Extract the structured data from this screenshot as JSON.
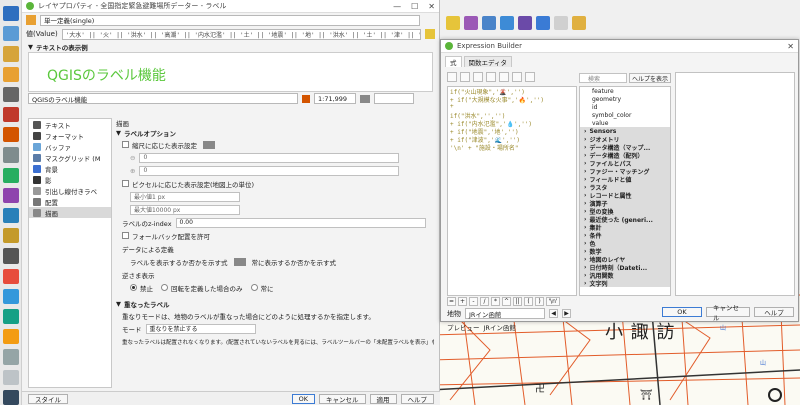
{
  "props_window": {
    "title": "レイヤプロパティ - 全国指定緊急避難場所データー - ラベル",
    "layer_mode": "単一定義(single)",
    "value_label": "値(Value)",
    "expression": "'大水' || '火' || '洪水' || '高潮' || '内水氾濫' || '土' || '地震' || '地' || '洪水' || '土' || '津' || '施設・場所名'",
    "sample_section": "テキストの表示例",
    "preview_text": "QGISのラベル機能",
    "sample_input": "QGISのラベル機能",
    "scale": "1:71,999",
    "categories": [
      {
        "label": "テキスト",
        "icon": "text-icon"
      },
      {
        "label": "フォーマット",
        "icon": "format-icon"
      },
      {
        "label": "バッファ",
        "icon": "buffer-icon"
      },
      {
        "label": "マスクグリッド (M",
        "icon": "mask-icon"
      },
      {
        "label": "背景",
        "icon": "background-icon"
      },
      {
        "label": "影",
        "icon": "shadow-icon"
      },
      {
        "label": "引出し線付きラベ",
        "icon": "callout-icon"
      },
      {
        "label": "配置",
        "icon": "placement-icon"
      },
      {
        "label": "描画",
        "icon": "rendering-icon"
      }
    ],
    "panel_title": "描画",
    "label_options": "ラベルオプション",
    "scale_visibility": "縮尺に応じた表示設定",
    "scale_min": "0",
    "scale_max": "0",
    "pixel_visibility": "ピクセルに応じた表示設定(地図上の単位)",
    "min_px": "最小値1 px",
    "max_px": "最大値10000 px",
    "z_index_label": "ラベルのz-index",
    "z_index_value": "0.00",
    "fallback": "フォールバック配置を許可",
    "data_defined": "データによる定義",
    "show_label": "ラベルを表示するか否かを示す式",
    "always_show": "常に表示するか否かを示す式",
    "upside_down": "逆さま表示",
    "opt_off": "禁止",
    "opt_rotated": "回転を定義した場合のみ",
    "opt_always": "常に",
    "overlap_section": "重なったラベル",
    "overlap_desc": "重なりモードは、地物のラベルが重なった場合にどのように処理するかを指定します。",
    "mode_label": "モード",
    "mode_value": "重なりを禁止する",
    "overlap_note": "重なったラベルは配置されなくなります。(配置されていないラベルを見るには、ラベルツールバーの「未配置ラベルを表示」をオンにしてください)",
    "buttons": {
      "style": "スタイル",
      "ok": "OK",
      "cancel": "キャンセル",
      "apply": "適用",
      "help": "ヘルプ"
    }
  },
  "expression_builder": {
    "title": "Expression Builder",
    "tabs": [
      "式",
      "関数エディタ"
    ],
    "code_lines": [
      "if(\"火山現象\",'🌋','')",
      "+ if(\"大規模な火事\",'🔥','')",
      "+",
      "if(\"洪水\",'','')",
      "+ if(\"内水氾濫\",'💧','')",
      "+ if(\"地震\",'地','')",
      "+ if(\"津波\",'🌊','')",
      "'\\n' + \"施設・場所名\""
    ],
    "search_placeholder": "検索",
    "help_button": "ヘルプを表示",
    "fields": [
      "feature",
      "geometry",
      "id",
      "symbol_color",
      "value"
    ],
    "groups": [
      "Sensors",
      "ジオメトリ",
      "データ構造（マップ...",
      "データ構造（配列）",
      "ファイルとパス",
      "ファジー・マッチング",
      "フィールドと値",
      "ラスタ",
      "レコードと属性",
      "演算子",
      "型の変換",
      "最近使った (generi...",
      "集計",
      "条件",
      "色",
      "数学",
      "地図のレイヤ",
      "日付時刻（Dateti...",
      "汎用関数",
      "文字列"
    ],
    "ops": [
      "=",
      "+",
      "-",
      "/",
      "*",
      "^",
      "||",
      "(",
      ")",
      "'\\n'"
    ],
    "feature_label": "地物",
    "feature_value": "JRイン函館",
    "preview_label": "プレビュー",
    "preview_value": "JRイン函館",
    "buttons": {
      "ok": "OK",
      "cancel": "キャンセル",
      "help": "ヘルプ"
    }
  },
  "map": {
    "place_label": "小 諏 訪"
  }
}
